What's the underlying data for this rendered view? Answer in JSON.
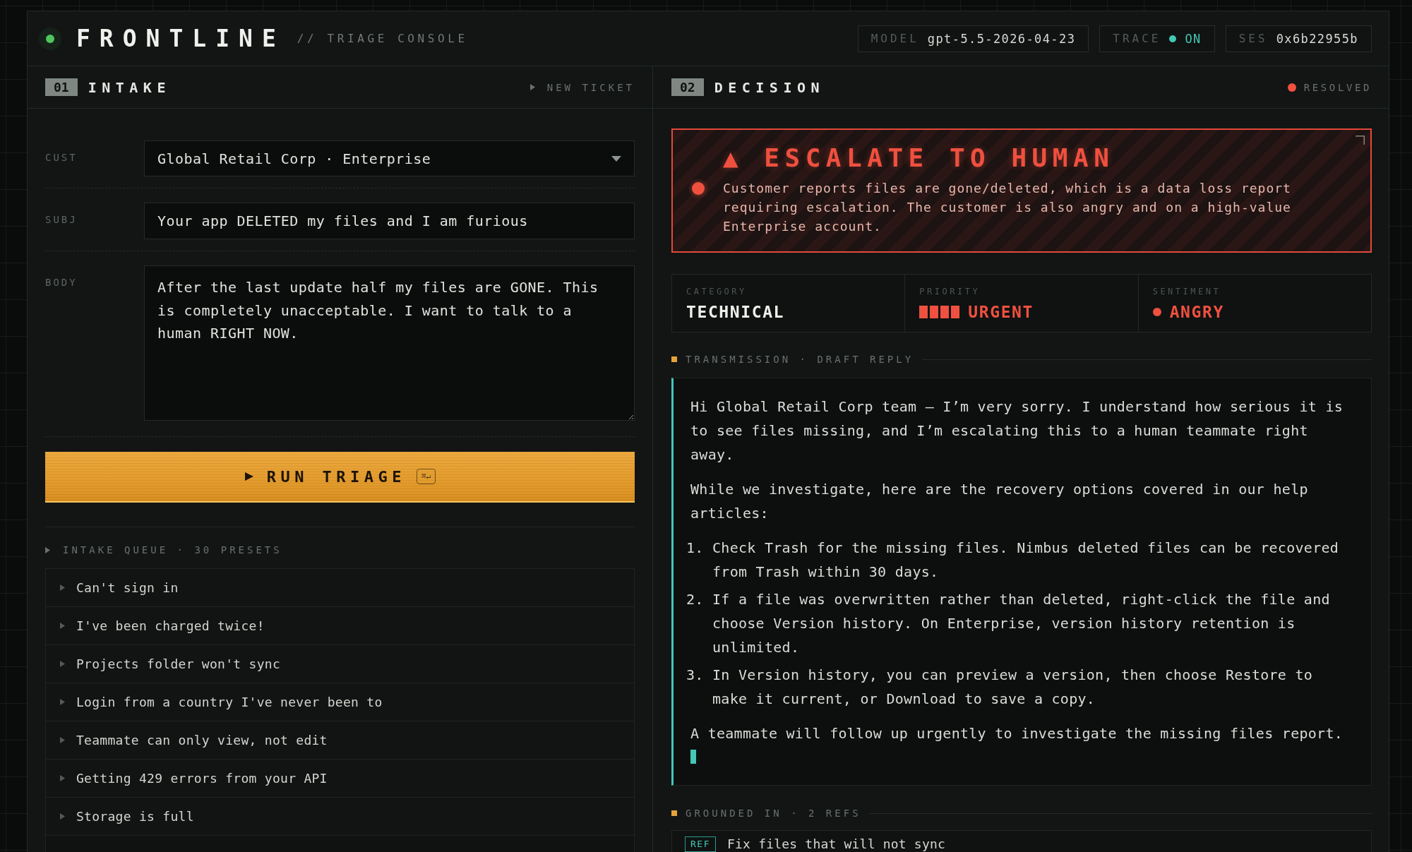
{
  "header": {
    "title": "FRONTLINE",
    "subtitle": "// TRIAGE CONSOLE",
    "model": {
      "label": "MODEL",
      "value": "gpt-5.5-2026-04-23"
    },
    "trace": {
      "label": "TRACE",
      "value": "ON",
      "on": true
    },
    "session": {
      "label": "SES",
      "value": "0x6b22955b"
    }
  },
  "intake": {
    "number": "01",
    "title": "INTAKE",
    "action": "NEW TICKET",
    "fields": [
      {
        "kind": "select",
        "label": "CUST",
        "value": "Global Retail Corp · Enterprise"
      },
      {
        "kind": "input",
        "label": "SUBJ",
        "value": "Your app DELETED my files and I am furious"
      },
      {
        "kind": "textarea",
        "label": "BODY",
        "value": "After the last update half my files are GONE. This is completely unacceptable. I want to talk to a human RIGHT NOW."
      }
    ],
    "run_button": {
      "label": "RUN TRIAGE",
      "shortcut": "⌘↵"
    },
    "queue": {
      "title": "INTAKE QUEUE · 30 PRESETS",
      "items": [
        "Can't sign in",
        "I've been charged twice!",
        "Projects folder won't sync",
        "Login from a country I've never been to",
        "Teammate can only view, not edit",
        "Getting 429 errors from your API",
        "Storage is full"
      ]
    }
  },
  "decision": {
    "number": "02",
    "title": "DECISION",
    "status": "RESOLVED",
    "verdict": {
      "title": "▲ ESCALATE TO HUMAN",
      "reason": "Customer reports files are gone/deleted, which is a data loss report requiring escalation. The customer is also angry and on a high-value Enterprise account."
    },
    "stats": [
      {
        "kind": "text",
        "label": "CATEGORY",
        "value": "TECHNICAL",
        "color": "#eef0ea"
      },
      {
        "kind": "meter",
        "label": "PRIORITY",
        "value": "URGENT",
        "color": "#f0503f",
        "level": 1
      },
      {
        "kind": "dot",
        "label": "SENTIMENT",
        "value": "ANGRY",
        "color": "#f0503f"
      }
    ],
    "draft": {
      "title": "TRANSMISSION · DRAFT REPLY",
      "blocks": [
        {
          "kind": "paragraph",
          "text": "Hi Global Retail Corp team — I’m very sorry. I understand how serious it is to see files missing, and I’m escalating this to a human teammate right away."
        },
        {
          "kind": "paragraph",
          "text": "While we investigate, here are the recovery options covered in our help articles:"
        },
        {
          "kind": "list",
          "items": [
            {
              "number": "1.",
              "text": "Check Trash for the missing files. Nimbus deleted files can be recovered from Trash within 30 days."
            },
            {
              "number": "2.",
              "text": "If a file was overwritten rather than deleted, right-click the file and choose Version history. On Enterprise, version history retention is unlimited."
            },
            {
              "number": "3.",
              "text": "In Version history, you can preview a version, then choose Restore to make it current, or Download to save a copy."
            }
          ]
        },
        {
          "kind": "paragraph",
          "text": "A teammate will follow up urgently to investigate the missing files report."
        }
      ]
    },
    "grounding": {
      "title": "GROUNDED IN · 2 REFS",
      "refs": [
        {
          "tag": "REF",
          "title": "Fix files that will not sync"
        }
      ]
    }
  }
}
